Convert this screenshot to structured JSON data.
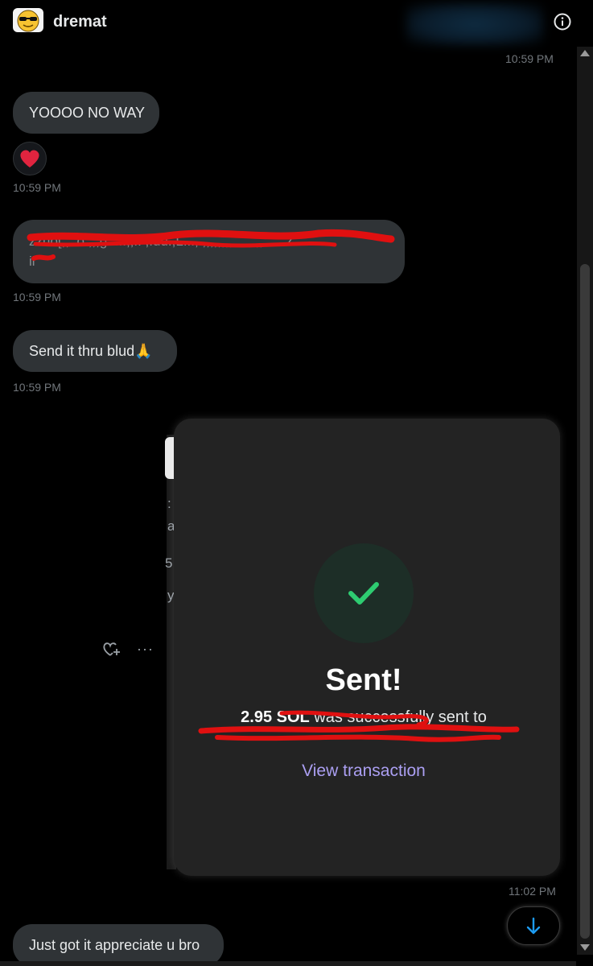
{
  "header": {
    "username": "dremat",
    "info_icon": "info-icon"
  },
  "messages": [
    {
      "time": "10:59 PM"
    },
    {
      "text": "YOOOO NO WAY",
      "reaction": "red-heart",
      "time": "10:59 PM"
    },
    {
      "text": "[redacted]",
      "time": "10:59 PM"
    },
    {
      "text": "Send it thru blud🙏",
      "time": "10:59 PM"
    }
  ],
  "card": {
    "title": "Sent!",
    "amount": "2.95 SOL",
    "amount_suffix": " was successfully sent to",
    "link": "View transaction",
    "time": "11:02 PM",
    "side_glyphs": [
      ":",
      "a",
      "5",
      "y"
    ]
  },
  "last_message": "Just got it appreciate u bro",
  "actions": {
    "more": "···"
  },
  "colors": {
    "accent": "#1d9bf0",
    "link": "#ab9ff2",
    "check": "#2ecc71",
    "heart": "#f91880",
    "redaction": "#e01010"
  }
}
